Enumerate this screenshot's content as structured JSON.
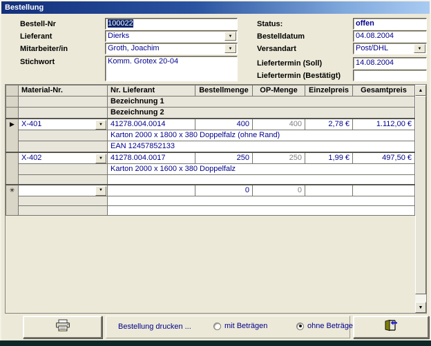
{
  "window": {
    "title": "Bestellung"
  },
  "form": {
    "bestell_nr": {
      "label": "Bestell-Nr",
      "value": "100022"
    },
    "lieferant": {
      "label": "Lieferant",
      "value": "Dierks"
    },
    "mitarbeiter": {
      "label": "Mitarbeiter/in",
      "value": "Groth, Joachim"
    },
    "stichwort": {
      "label": "Stichwort",
      "value": "Komm. Grotex 20-04"
    },
    "status": {
      "label": "Status:",
      "value": "offen"
    },
    "bestelldatum": {
      "label": "Bestelldatum",
      "value": "04.08.2004"
    },
    "versandart": {
      "label": "Versandart",
      "value": "Post/DHL"
    },
    "liefertermin_soll": {
      "label": "Liefertermin (Soll)",
      "value": "14.08.2004"
    },
    "liefertermin_bestaetigt": {
      "label": "Liefertermin (Bestätigt)",
      "value": ""
    }
  },
  "grid": {
    "columns": [
      "Material-Nr.",
      "Nr. Lieferant",
      "Bestellmenge",
      "OP-Menge",
      "Einzelpreis",
      "Gesamtpreis"
    ],
    "subheaders": {
      "b1": "Bezeichnung 1",
      "b2": "Bezeichnung 2"
    },
    "selector_icons": {
      "current": "▶",
      "new": "✳"
    },
    "rows": [
      {
        "selector": "current",
        "material": "X-401",
        "lieferant_nr": "41278.004.0014",
        "menge": "400",
        "op": "400",
        "einzel": "2,78 €",
        "gesamt": "1.112,00 €",
        "bez1": "Karton 2000 x 1800 x 380 Doppelfalz (ohne Rand)",
        "bez2": "EAN 12457852133"
      },
      {
        "selector": "",
        "material": "X-402",
        "lieferant_nr": "41278.004.0017",
        "menge": "250",
        "op": "250",
        "einzel": "1,99 €",
        "gesamt": "497,50 €",
        "bez1": "Karton 2000 x 1600 x 380 Doppelfalz",
        "bez2": ""
      },
      {
        "selector": "new",
        "material": "",
        "lieferant_nr": "",
        "menge": "0",
        "op": "0",
        "einzel": "",
        "gesamt": "",
        "bez1": "",
        "bez2": ""
      }
    ]
  },
  "footer": {
    "print_label": "Bestellung drucken ...",
    "radio_mit": "mit Beträgen",
    "radio_ohne": "ohne Beträge",
    "selected": "ohne Beträge"
  },
  "icons": {
    "combo_arrow": "▼",
    "scroll_up": "▲",
    "scroll_down": "▼"
  },
  "colors": {
    "value_text": "#00008B",
    "disabled_text": "#7F7F7F",
    "title_gradient_start": "#13307C",
    "title_gradient_end": "#A9CBF2",
    "background": "#ECE9D8",
    "grid_gray": "#E8E5DA",
    "selector_gray": "#DAD6C7",
    "selection_bg": "#0A246A",
    "door_olive": "#7F7F00",
    "exit_arrow_blue": "#2222CC",
    "bottom_strip": "#0E2828"
  }
}
